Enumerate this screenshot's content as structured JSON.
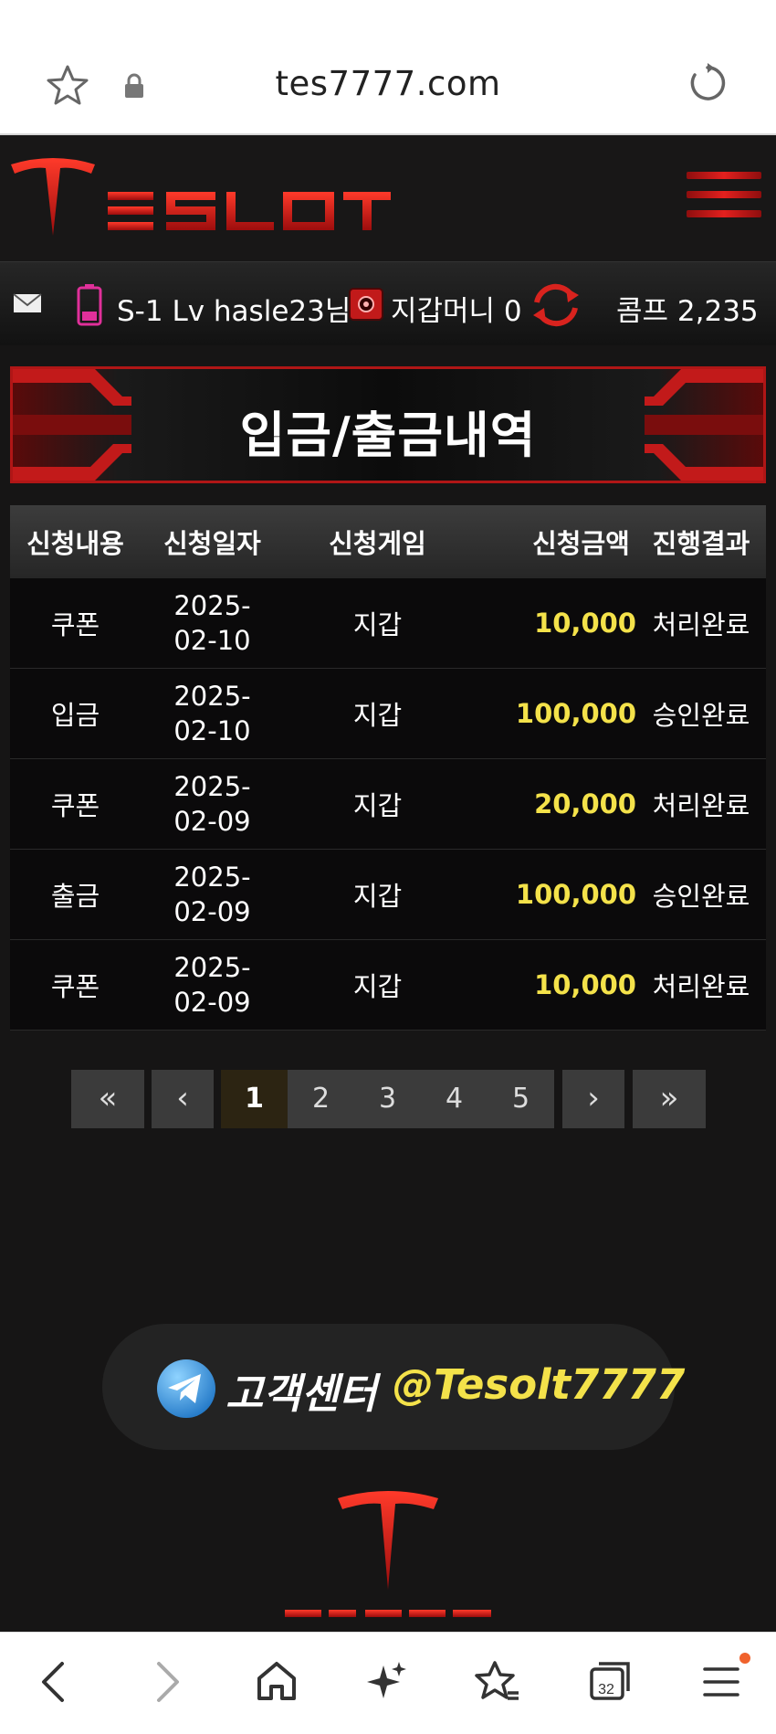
{
  "browser": {
    "url": "tes7777.com",
    "tab_count": "32",
    "icons": [
      "star-icon",
      "lock-icon",
      "reload-icon",
      "back-icon",
      "forward-icon",
      "home-icon",
      "sparkle-icon",
      "bookmarks-icon",
      "tabs-icon",
      "menu-icon"
    ]
  },
  "site": {
    "logo_text": "TESLOT"
  },
  "user_bar": {
    "level_user": "S-1 Lv hasle23님",
    "wallet": "지갑머니 0",
    "comp": "콤프 2,235"
  },
  "title": "입금/출금내역",
  "table": {
    "headers": [
      "신청내용",
      "신청일자",
      "신청게임",
      "신청금액",
      "진행결과"
    ],
    "rows": [
      {
        "type": "쿠폰",
        "date": "2025-02-10",
        "game": "지갑",
        "amount": "10,000",
        "result": "처리완료"
      },
      {
        "type": "입금",
        "date": "2025-02-10",
        "game": "지갑",
        "amount": "100,000",
        "result": "승인완료"
      },
      {
        "type": "쿠폰",
        "date": "2025-02-09",
        "game": "지갑",
        "amount": "20,000",
        "result": "처리완료"
      },
      {
        "type": "출금",
        "date": "2025-02-09",
        "game": "지갑",
        "amount": "100,000",
        "result": "승인완료"
      },
      {
        "type": "쿠폰",
        "date": "2025-02-09",
        "game": "지갑",
        "amount": "10,000",
        "result": "처리완료"
      }
    ]
  },
  "pagination": {
    "first": "«",
    "prev": "‹",
    "pages": [
      "1",
      "2",
      "3",
      "4",
      "5"
    ],
    "active_page": "1",
    "next": "›",
    "last": "»"
  },
  "support": {
    "label": "고객센터",
    "handle": "@Tesolt7777"
  },
  "colors": {
    "accent_red": "#d91f1f",
    "amount_yellow": "#f4e24a",
    "background": "#161515"
  }
}
